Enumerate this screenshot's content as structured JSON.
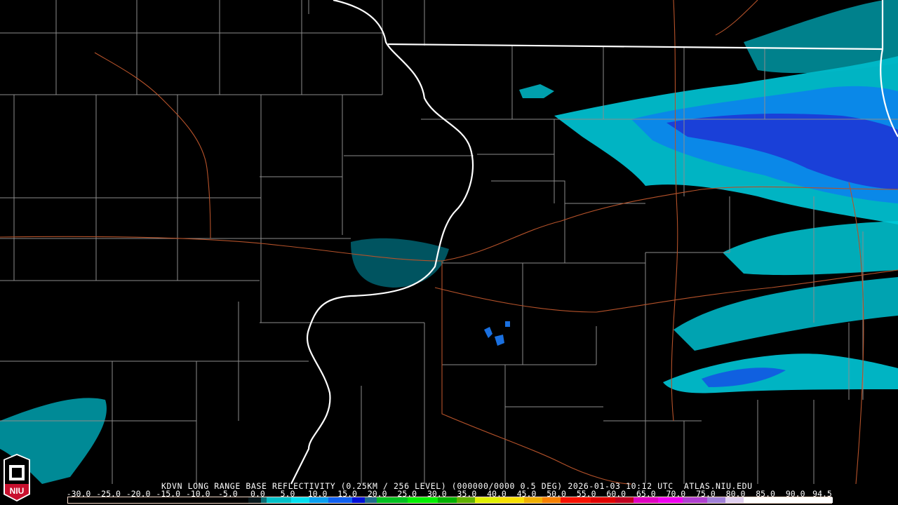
{
  "product_title": "KDVN LONG RANGE BASE REFLECTIVITY (0.25KM / 256 LEVEL) (000000/0000 0.5 DEG) 2026-01-03 10:12 UTC  ATLAS.NIU.EDU",
  "logo": {
    "text": "NIU"
  },
  "colorbar": {
    "labels": [
      "-30.0",
      "-25.0",
      "-20.0",
      "-15.0",
      "-10.0",
      "-5.0",
      "0.0",
      "5.0",
      "10.0",
      "15.0",
      "20.0",
      "25.0",
      "30.0",
      "35.0",
      "40.0",
      "45.0",
      "50.0",
      "55.0",
      "60.0",
      "65.0",
      "70.0",
      "75.0",
      "80.0",
      "85.0",
      "90.0",
      "94.5"
    ],
    "range": [
      -30,
      94.5
    ],
    "stops": [
      {
        "v": -30,
        "c": "#000000"
      },
      {
        "v": -3,
        "c": "#000000"
      },
      {
        "v": -1,
        "c": "#0a1a1e"
      },
      {
        "v": 1,
        "c": "#0b6e74"
      },
      {
        "v": 2,
        "c": "#00c0c8"
      },
      {
        "v": 6,
        "c": "#00e0f0"
      },
      {
        "v": 9,
        "c": "#0aa0f0"
      },
      {
        "v": 12,
        "c": "#1060f0"
      },
      {
        "v": 16,
        "c": "#0010d8"
      },
      {
        "v": 18,
        "c": "#206c8c"
      },
      {
        "v": 20,
        "c": "#00c020"
      },
      {
        "v": 25,
        "c": "#00f000"
      },
      {
        "v": 30,
        "c": "#00b000"
      },
      {
        "v": 33,
        "c": "#60b000"
      },
      {
        "v": 36,
        "c": "#e0f000"
      },
      {
        "v": 40,
        "c": "#f8e000"
      },
      {
        "v": 44,
        "c": "#f0b000"
      },
      {
        "v": 47,
        "c": "#f88000"
      },
      {
        "v": 50,
        "c": "#f81000"
      },
      {
        "v": 55,
        "c": "#e00000"
      },
      {
        "v": 59,
        "c": "#c00020"
      },
      {
        "v": 62,
        "c": "#e000c0"
      },
      {
        "v": 66,
        "c": "#f000f0"
      },
      {
        "v": 70,
        "c": "#b040d0"
      },
      {
        "v": 74,
        "c": "#a080d8"
      },
      {
        "v": 77,
        "c": "#e0d0f0"
      },
      {
        "v": 80,
        "c": "#ffffff"
      },
      {
        "v": 94.5,
        "c": "#ffffff"
      }
    ]
  },
  "colors": {
    "state_border": "#ffffff",
    "county_border": "#8c8c8c",
    "roads": "#b5522a",
    "echo_light": "#00d8e8",
    "echo_mid": "#0a9ee8",
    "echo_core": "#1848e0"
  }
}
